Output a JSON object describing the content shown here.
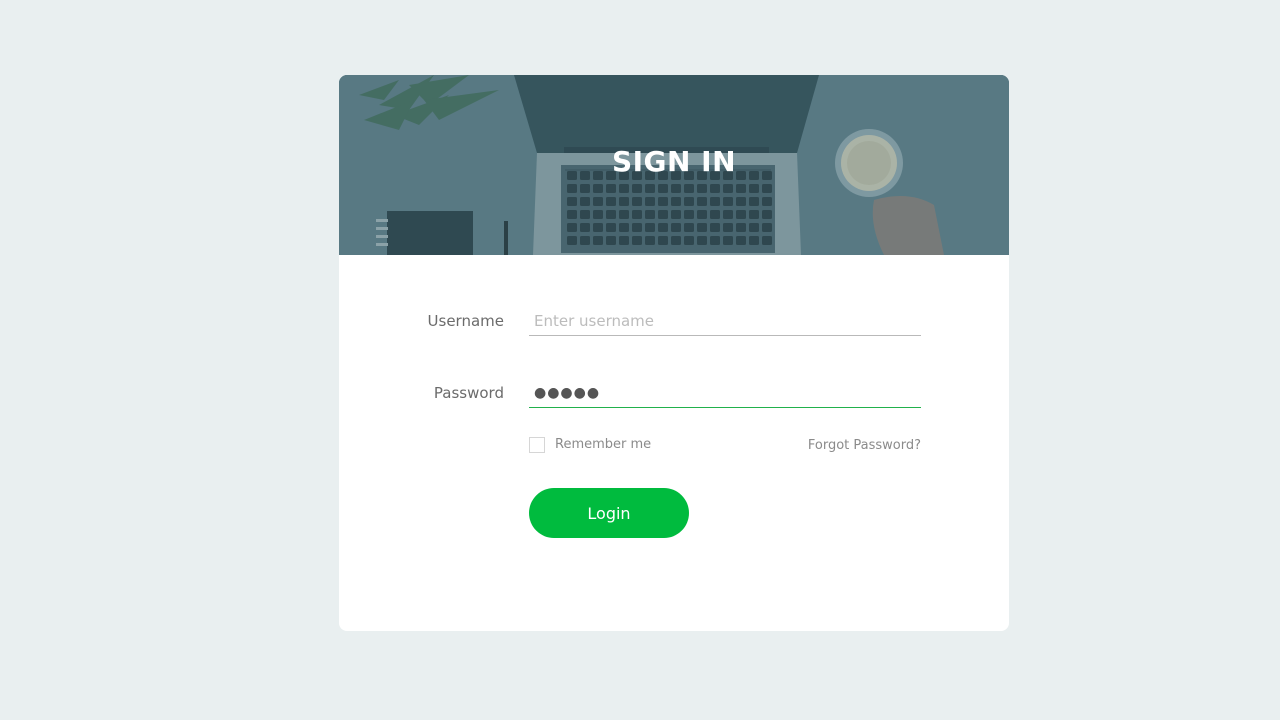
{
  "header": {
    "title": "SIGN IN"
  },
  "form": {
    "username": {
      "label": "Username",
      "placeholder": "Enter username",
      "value": ""
    },
    "password": {
      "label": "Password",
      "value": "●●●●●"
    },
    "remember_label": "Remember me",
    "forgot_label": "Forgot Password?",
    "login_label": "Login"
  },
  "colors": {
    "background": "#e9eff0",
    "accent": "#00bb3e",
    "focus_underline": "#21b14b",
    "hero_overlay": "#5a7a83"
  }
}
